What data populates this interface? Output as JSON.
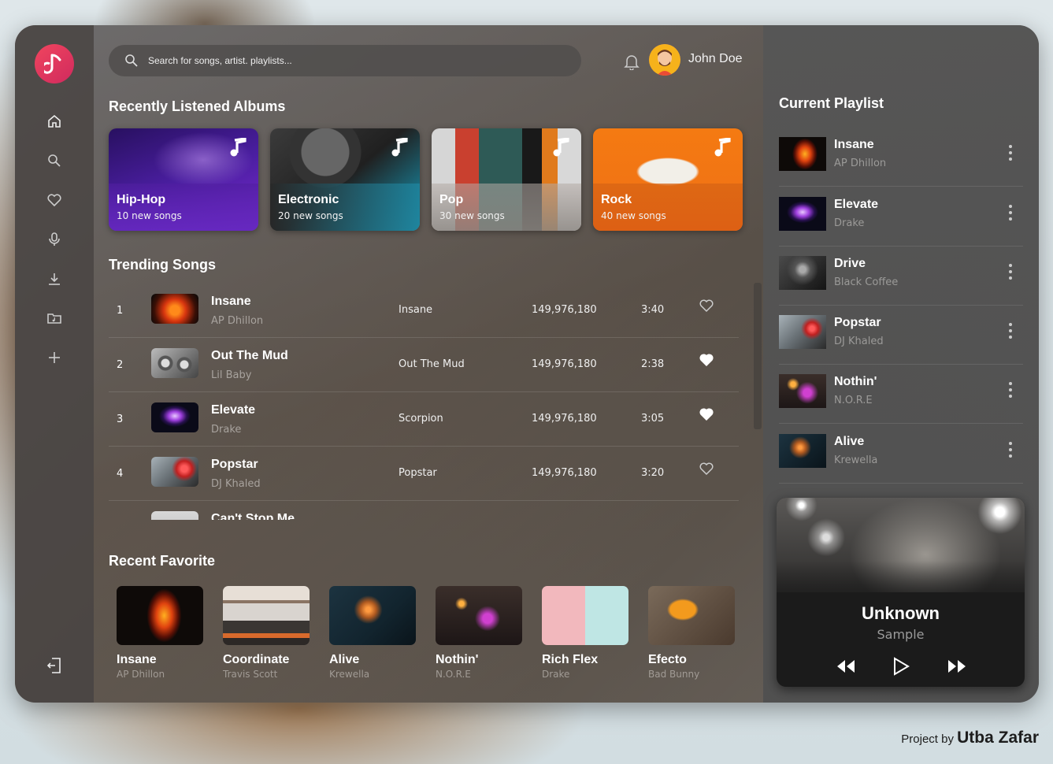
{
  "search": {
    "placeholder": "Search for songs, artist. playlists..."
  },
  "user": {
    "name": "John Doe"
  },
  "sections": {
    "recent_albums": "Recently Listened Albums",
    "trending": "Trending Songs",
    "recent_favorite": "Recent Favorite",
    "current_playlist": "Current Playlist"
  },
  "sidebar": {
    "items": [
      {
        "icon": "home-icon"
      },
      {
        "icon": "search-icon"
      },
      {
        "icon": "heart-icon"
      },
      {
        "icon": "microphone-icon"
      },
      {
        "icon": "download-icon"
      },
      {
        "icon": "music-folder-icon"
      },
      {
        "icon": "plus-icon"
      }
    ],
    "logout_icon": "logout-icon"
  },
  "albums": [
    {
      "genre": "Hip-Hop",
      "count": "10 new songs",
      "color": "#5b2bb5"
    },
    {
      "genre": "Electronic",
      "count": "20 new songs",
      "color": "#1f8fa0"
    },
    {
      "genre": "Pop",
      "count": "30 new songs",
      "color": "#e47a2a"
    },
    {
      "genre": "Rock",
      "count": "40 new songs",
      "color": "#f07a19"
    }
  ],
  "trending": [
    {
      "num": "1",
      "title": "Insane",
      "artist": "AP Dhillon",
      "album": "Insane",
      "plays": "149,976,180",
      "duration": "3:40",
      "liked": false
    },
    {
      "num": "2",
      "title": "Out The Mud",
      "artist": "Lil Baby",
      "album": "Out The Mud",
      "plays": "149,976,180",
      "duration": "2:38",
      "liked": true
    },
    {
      "num": "3",
      "title": "Elevate",
      "artist": "Drake",
      "album": "Scorpion",
      "plays": "149,976,180",
      "duration": "3:05",
      "liked": true
    },
    {
      "num": "4",
      "title": "Popstar",
      "artist": "DJ Khaled",
      "album": "Popstar",
      "plays": "149,976,180",
      "duration": "3:20",
      "liked": false
    },
    {
      "num": "",
      "title": "Can't Stop Me",
      "artist": "",
      "album": "",
      "plays": "",
      "duration": "",
      "liked": false
    }
  ],
  "favorites": [
    {
      "title": "Insane",
      "artist": "AP Dhillon"
    },
    {
      "title": "Coordinate",
      "artist": "Travis Scott"
    },
    {
      "title": "Alive",
      "artist": "Krewella"
    },
    {
      "title": "Nothin'",
      "artist": "N.O.R.E"
    },
    {
      "title": "Rich Flex",
      "artist": "Drake"
    },
    {
      "title": "Efecto",
      "artist": "Bad Bunny"
    }
  ],
  "playlist": [
    {
      "title": "Insane",
      "artist": "AP Dhillon"
    },
    {
      "title": "Elevate",
      "artist": "Drake"
    },
    {
      "title": "Drive",
      "artist": "Black Coffee"
    },
    {
      "title": "Popstar",
      "artist": "DJ Khaled"
    },
    {
      "title": "Nothin'",
      "artist": "N.O.R.E"
    },
    {
      "title": "Alive",
      "artist": "Krewella"
    }
  ],
  "player": {
    "title": "Unknown",
    "subtitle": "Sample"
  },
  "credit": {
    "prefix": "Project by",
    "author": "Utba Zafar"
  },
  "colors": {
    "accent": "#e8385d",
    "heart": "#ffffff"
  }
}
